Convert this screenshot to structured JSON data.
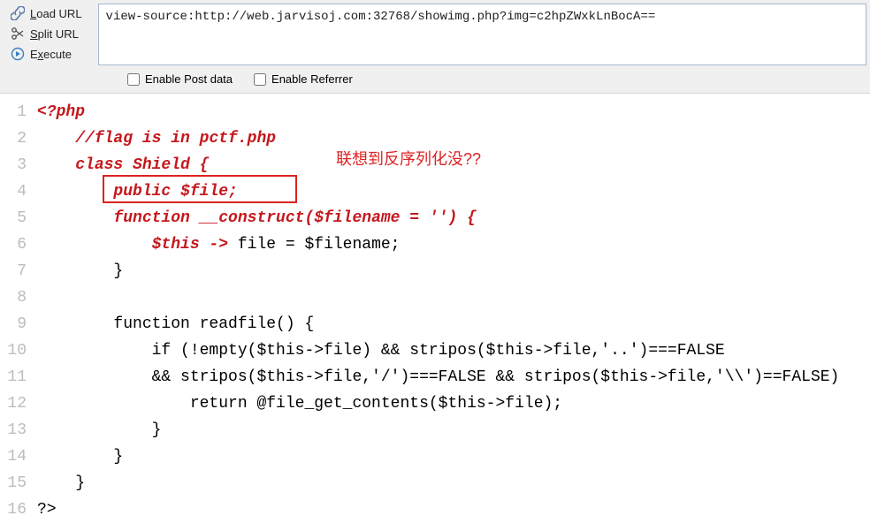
{
  "toolbar": {
    "load_url": {
      "label": "Load URL",
      "accesskey": "L",
      "icon": "link-icon"
    },
    "split_url": {
      "label": "Split URL",
      "accesskey": "S",
      "icon": "split-icon"
    },
    "execute": {
      "label": "Execute",
      "accesskey": "x",
      "icon": "play-icon"
    }
  },
  "url_input": "view-source:http://web.jarvisoj.com:32768/showimg.php?img=c2hpZWxkLnBocA==",
  "checks": {
    "post": {
      "label": "Enable Post data",
      "checked": false
    },
    "referer": {
      "label": "Enable Referrer",
      "checked": false
    }
  },
  "annotation": "联想到反序列化没??",
  "code_lines": [
    {
      "n": 1,
      "segments": [
        {
          "t": "<?php",
          "c": "k-redi"
        }
      ]
    },
    {
      "n": 2,
      "segments": [
        {
          "t": "    ",
          "c": "k-blk"
        },
        {
          "t": "//flag is in pctf.php",
          "c": "k-redi"
        }
      ]
    },
    {
      "n": 3,
      "segments": [
        {
          "t": "    ",
          "c": "k-blk"
        },
        {
          "t": "class Shield {",
          "c": "k-redi"
        }
      ]
    },
    {
      "n": 4,
      "segments": [
        {
          "t": "        ",
          "c": "k-blk"
        },
        {
          "t": "public $file;",
          "c": "k-redi"
        }
      ]
    },
    {
      "n": 5,
      "segments": [
        {
          "t": "        ",
          "c": "k-blk"
        },
        {
          "t": "function __construct($filename = '') {",
          "c": "k-redi"
        }
      ]
    },
    {
      "n": 6,
      "segments": [
        {
          "t": "            ",
          "c": "k-blk"
        },
        {
          "t": "$this ->",
          "c": "k-redi"
        },
        {
          "t": " file = $filename;",
          "c": "k-blk"
        }
      ]
    },
    {
      "n": 7,
      "segments": [
        {
          "t": "        }",
          "c": "k-blk"
        }
      ]
    },
    {
      "n": 8,
      "segments": [
        {
          "t": "",
          "c": "k-blk"
        }
      ]
    },
    {
      "n": 9,
      "segments": [
        {
          "t": "        function readfile() {",
          "c": "k-blk"
        }
      ]
    },
    {
      "n": 10,
      "segments": [
        {
          "t": "            if (!empty($this->file) && stripos($this->file,'..')===FALSE",
          "c": "k-blk"
        }
      ]
    },
    {
      "n": 11,
      "segments": [
        {
          "t": "            && stripos($this->file,'/')===FALSE && stripos($this->file,'\\\\')==FALSE) ",
          "c": "k-blk"
        }
      ]
    },
    {
      "n": 12,
      "segments": [
        {
          "t": "                return @file_get_contents($this->file);",
          "c": "k-blk"
        }
      ]
    },
    {
      "n": 13,
      "segments": [
        {
          "t": "            }",
          "c": "k-blk"
        }
      ]
    },
    {
      "n": 14,
      "segments": [
        {
          "t": "        }",
          "c": "k-blk"
        }
      ]
    },
    {
      "n": 15,
      "segments": [
        {
          "t": "    }",
          "c": "k-blk"
        }
      ]
    },
    {
      "n": 16,
      "segments": [
        {
          "t": "?>",
          "c": "k-blk"
        }
      ]
    }
  ]
}
